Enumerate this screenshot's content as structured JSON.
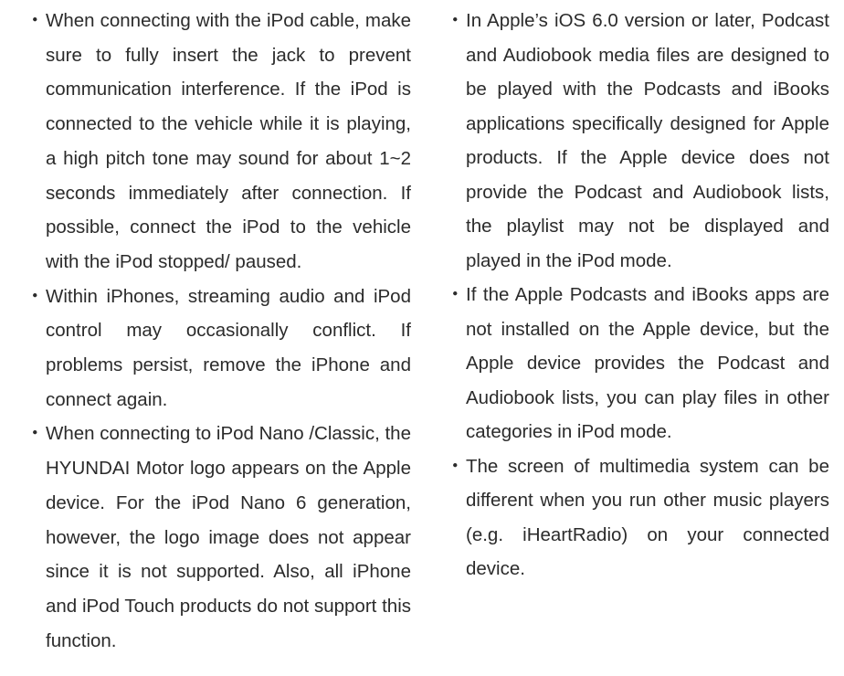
{
  "bullet_symbol": "・",
  "left_column": {
    "items": [
      "When connecting with the iPod cable, make sure to fully insert the jack to prevent communication interference. If the iPod is connected to the vehicle while it is playing, a high pitch tone may sound for about 1~2 seconds immediately after connection. If possible, connect the iPod to the vehicle with the iPod stopped/ paused.",
      "Within iPhones, streaming audio and iPod control may occasionally conflict. If problems persist, remove the iPhone and connect again.",
      "When connecting to iPod Nano /Classic, the HYUNDAI Motor logo appears on the Apple device. For the iPod Nano 6 generation, however, the logo image does not appear since it is not supported. Also, all iPhone and iPod Touch products do not support this function."
    ]
  },
  "right_column": {
    "items": [
      "In Apple’s iOS 6.0 version or later, Podcast and Audiobook media files are designed to be played with the Podcasts and iBooks applications specifically designed for Apple products. If the Apple device does not provide the Podcast and Audiobook lists, the playlist may not be displayed and played in the iPod mode.",
      "If the Apple Podcasts and iBooks apps are not installed on the Apple device, but the Apple device provides the Podcast and Audiobook lists, you can play files in other categories in iPod mode.",
      "The screen of multimedia system can be different when you run other music players (e.g. iHeartRadio) on your connected device."
    ]
  }
}
